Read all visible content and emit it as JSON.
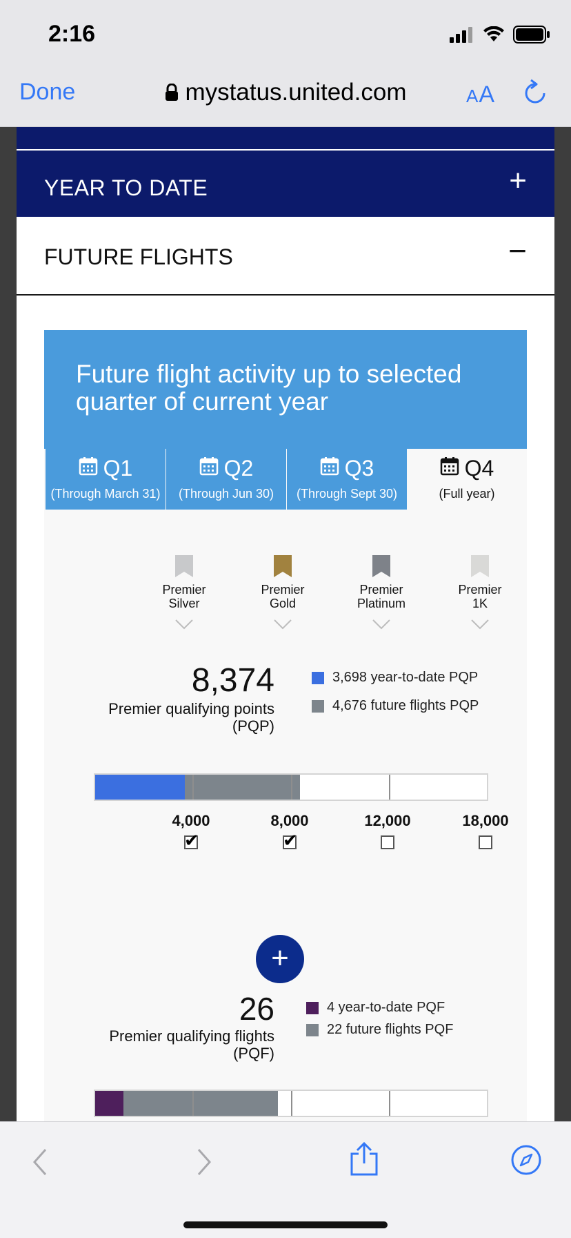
{
  "status_bar": {
    "time": "2:16"
  },
  "browser": {
    "done_label": "Done",
    "url": "mystatus.united.com",
    "aa_label_small": "A",
    "aa_label_large": "A"
  },
  "accordion": {
    "year_to_date": {
      "label": "YEAR TO DATE",
      "toggle": "+"
    },
    "future_flights": {
      "label": "FUTURE FLIGHTS",
      "toggle": "−"
    }
  },
  "hero": {
    "title": "Future flight activity up to selected quarter of current year"
  },
  "quarters": [
    {
      "label": "Q1",
      "sub": "(Through March 31)",
      "selected": false
    },
    {
      "label": "Q2",
      "sub": "(Through Jun 30)",
      "selected": false
    },
    {
      "label": "Q3",
      "sub": "(Through Sept 30)",
      "selected": false
    },
    {
      "label": "Q4",
      "sub": "(Full year)",
      "selected": true
    }
  ],
  "tiers": [
    {
      "line1": "Premier",
      "line2": "Silver",
      "color": "#c8c9cb"
    },
    {
      "line1": "Premier",
      "line2": "Gold",
      "color": "#a1823f"
    },
    {
      "line1": "Premier",
      "line2": "Platinum",
      "color": "#7e8289"
    },
    {
      "line1": "Premier",
      "line2": "1K",
      "color": "#d9d9d7"
    }
  ],
  "pqp": {
    "total": "8,374",
    "label_line1": "Premier qualifying points",
    "label_line2": "(PQP)",
    "legend": [
      {
        "text": "3,698 year-to-date PQP",
        "color": "#3b6fe0"
      },
      {
        "text": "4,676 future flights PQP",
        "color": "#7d858c"
      }
    ],
    "year_to_date_value": 3698,
    "future_value": 4676,
    "thresholds": [
      {
        "label": "4,000",
        "value": 4000,
        "checked": true
      },
      {
        "label": "8,000",
        "value": 8000,
        "checked": true
      },
      {
        "label": "12,000",
        "value": 12000,
        "checked": false
      },
      {
        "label": "18,000",
        "value": 18000,
        "checked": false
      }
    ]
  },
  "pqf": {
    "total": "26",
    "label_line1": "Premier qualifying flights",
    "label_line2": "(PQF)",
    "legend": [
      {
        "text": "4 year-to-date PQF",
        "color": "#4e1f5c"
      },
      {
        "text": "22 future flights PQF",
        "color": "#7d858c"
      }
    ],
    "year_to_date_value": 4,
    "future_value": 22
  },
  "add_button_label": "+"
}
